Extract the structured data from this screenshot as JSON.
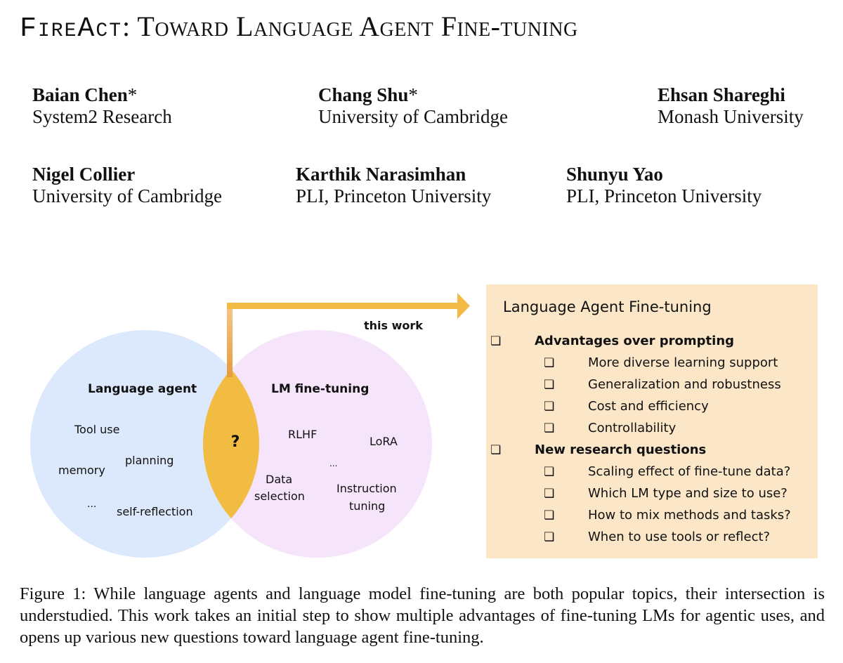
{
  "paper": {
    "title_prefix": "FireAct",
    "title_rest": ": Toward Language Agent Fine-tuning",
    "authors": [
      {
        "name": "Baian Chen",
        "mark": "*",
        "affiliation": "System2 Research"
      },
      {
        "name": "Chang Shu",
        "mark": "*",
        "affiliation": "University of Cambridge"
      },
      {
        "name": "Ehsan Shareghi",
        "mark": "",
        "affiliation": "Monash University"
      },
      {
        "name": "Nigel Collier",
        "mark": "",
        "affiliation": "University of Cambridge"
      },
      {
        "name": "Karthik Narasimhan",
        "mark": "",
        "affiliation": "PLI, Princeton University"
      },
      {
        "name": "Shunyu Yao",
        "mark": "",
        "affiliation": "PLI, Princeton University"
      }
    ],
    "caption": "Figure 1: While language agents and language model fine-tuning are both popular topics, their intersection is understudied. This work takes an initial step to show multiple advantages of fine-tuning LMs for agentic uses, and opens up various new questions toward language agent fine-tuning."
  },
  "figure": {
    "colors": {
      "left_circle": "#dce8fb",
      "right_circle": "#f6e4fb",
      "intersection": "#f2bb42",
      "arrow": "#f3bb45",
      "arrow_stem_bottom": "#e89a3c",
      "box_bg": "#fbe6c8"
    },
    "arrow_label": "this work",
    "intersection_label": "?",
    "left_set": {
      "title": "Language agent",
      "items": [
        "Tool use",
        "planning",
        "memory",
        "...",
        "self-reflection"
      ]
    },
    "right_set": {
      "title": "LM fine-tuning",
      "items": [
        "RLHF",
        "LoRA",
        "...",
        "Data",
        "selection",
        "Instruction",
        "tuning"
      ]
    },
    "box": {
      "title": "Language Agent Fine-tuning",
      "checkbox_glyph": "❏",
      "sections": [
        {
          "label": "Advantages over prompting",
          "items": [
            "More diverse learning support",
            "Generalization and robustness",
            "Cost and efficiency",
            "Controllability"
          ]
        },
        {
          "label": "New research questions",
          "items": [
            "Scaling effect of fine-tune data?",
            "Which LM type and size to use?",
            "How to mix methods and tasks?",
            "When to use tools or reflect?"
          ]
        }
      ]
    }
  }
}
